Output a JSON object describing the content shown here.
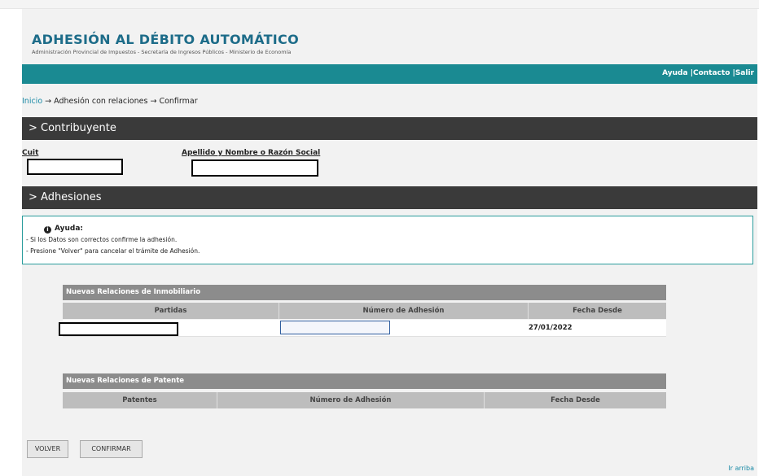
{
  "header": {
    "title": "ADHESIÓN AL DÉBITO AUTOMÁTICO",
    "subtitle": "Administración Provincial de Impuestos - Secretaría de Ingresos Públicos - Ministerio de Economía"
  },
  "nav": {
    "ayuda": "Ayuda",
    "contacto": "Contacto",
    "salir": "Salir",
    "sep": "|"
  },
  "breadcrumb": {
    "inicio": "Inicio",
    "arrow": "→",
    "step1": "Adhesión con relaciones",
    "step2": "Confirmar"
  },
  "contribuyente": {
    "section_title": "> Contribuyente",
    "cuit_label": "Cuit",
    "nombre_label": "Apellido y Nombre o Razón Social"
  },
  "adhesiones": {
    "section_title": "> Adhesiones",
    "help_title": "Ayuda:",
    "help_icon": "info-icon",
    "help_lines": [
      "- Si los Datos son correctos confirme la adhesión.",
      "- Presione \"Volver\" para cancelar el trámite de Adhesión."
    ]
  },
  "inmobiliario": {
    "title": "Nuevas Relaciones de Inmobiliario",
    "columns": [
      "Partidas",
      "Número de Adhesión",
      "Fecha Desde"
    ],
    "rows": [
      {
        "partida": "",
        "numero": "",
        "fecha": "27/01/2022"
      }
    ]
  },
  "patente": {
    "title": "Nuevas Relaciones de Patente",
    "columns": [
      "Patentes",
      "Número de Adhesión",
      "Fecha Desde"
    ]
  },
  "buttons": {
    "volver": "VOLVER",
    "confirmar": "CONFIRMAR"
  },
  "footer": {
    "ir_arriba": "Ir arriba"
  },
  "colors": {
    "title": "#1d6c89",
    "navbar": "#1a8a92",
    "section_bar": "#3a3a3a",
    "table_header": "#8c8c8c",
    "column_header": "#bdbdbd"
  }
}
